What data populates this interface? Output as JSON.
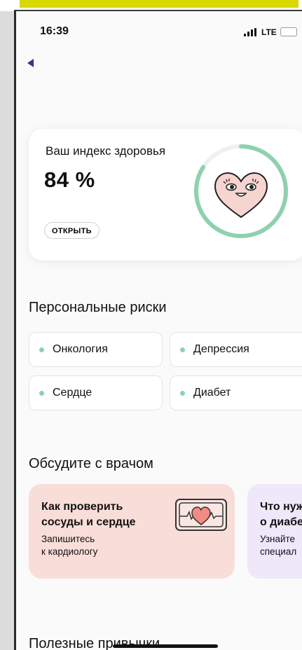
{
  "status_bar": {
    "time": "16:39",
    "network": "LTE"
  },
  "health_index": {
    "title": "Ваш индекс здоровья",
    "value": "84 %",
    "percent": 84,
    "open_button": "ОТКРЫТЬ",
    "gauge_color": "#8ed1ae",
    "heart_color": "#f6d4cf"
  },
  "risks": {
    "title": "Персональные риски",
    "items": [
      {
        "label": "Онкология"
      },
      {
        "label": "Депрессия"
      },
      {
        "label": "Сердце"
      },
      {
        "label": "Диабет"
      }
    ],
    "dot_color": "#8ed1ae"
  },
  "discuss": {
    "title": "Обсудите с врачом",
    "cards": [
      {
        "title": "Как проверить\nсосуды и сердце",
        "subtitle": "Запишитесь\nк кардиологу",
        "icon": "heart-monitor-icon",
        "color": "#f9ddd8"
      },
      {
        "title": "Что нуж\nо диабе",
        "subtitle": "Узнайте\nспециал",
        "color": "#efe8fb"
      }
    ]
  },
  "habits": {
    "title": "Полезные привычки"
  },
  "colors": {
    "accent": "#4b2a8c",
    "banner": "#d8d900"
  }
}
